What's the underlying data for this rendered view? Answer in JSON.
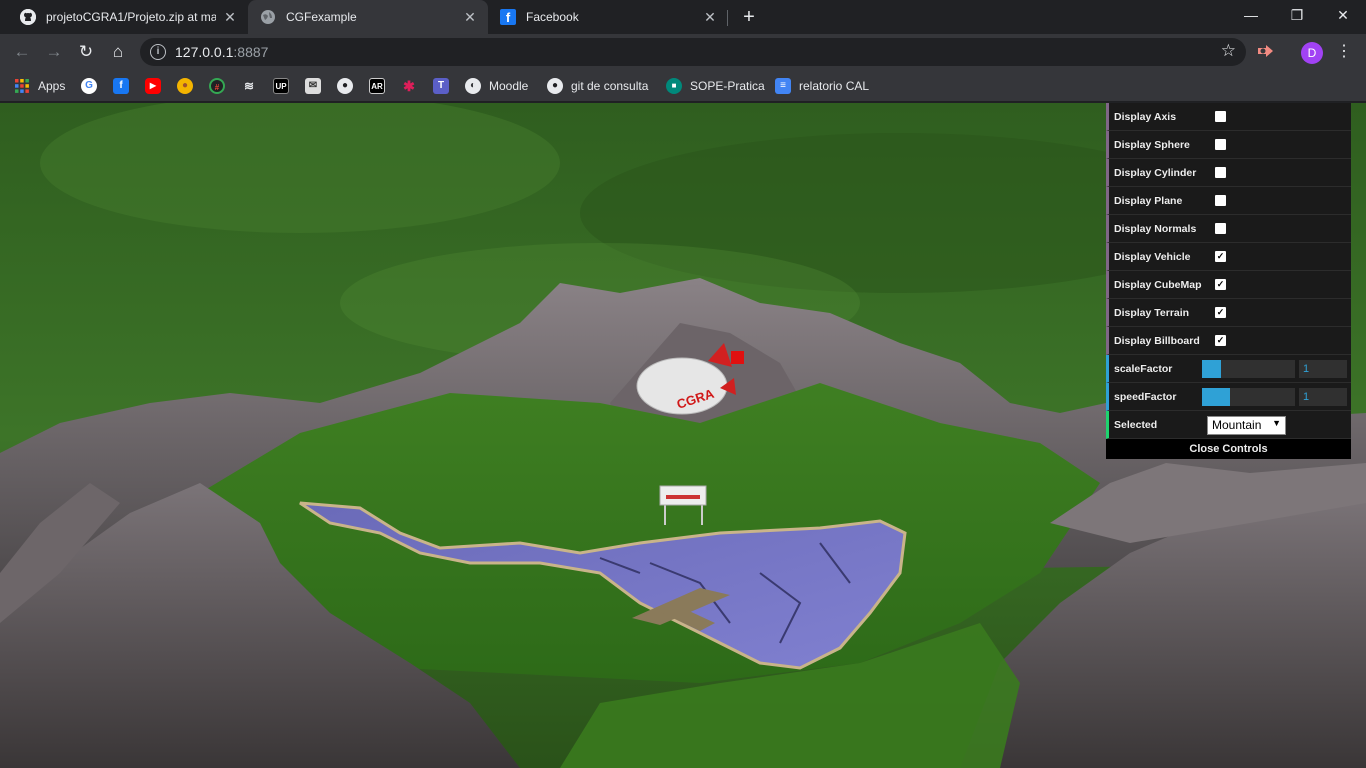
{
  "tabs": [
    {
      "title": "projetoCGRA1/Projeto.zip at mas",
      "favicon": "github-icon"
    },
    {
      "title": "CGFexample",
      "favicon": "globe-icon"
    },
    {
      "title": "Facebook",
      "favicon": "facebook-icon"
    }
  ],
  "window_controls": {
    "minimize": "—",
    "maximize": "❐",
    "close": "✕"
  },
  "address_bar": {
    "host": "127.0.0.1",
    "port": ":8887"
  },
  "profile": {
    "initial": "D"
  },
  "bookmarks": [
    {
      "label": "Apps",
      "icon": "apps-grid-icon"
    },
    {
      "label": "",
      "icon": "google-icon"
    },
    {
      "label": "",
      "icon": "facebook-icon"
    },
    {
      "label": "",
      "icon": "youtube-icon"
    },
    {
      "label": "",
      "icon": "chrome-extension-icon"
    },
    {
      "label": "",
      "icon": "bookmark-icon-5"
    },
    {
      "label": "",
      "icon": "bookmark-icon-6"
    },
    {
      "label": "",
      "icon": "bookmark-icon-7"
    },
    {
      "label": "",
      "icon": "mail-icon"
    },
    {
      "label": "",
      "icon": "github-icon"
    },
    {
      "label": "",
      "icon": "ar-icon"
    },
    {
      "label": "",
      "icon": "slack-icon"
    },
    {
      "label": "",
      "icon": "teams-icon"
    },
    {
      "label": "Moodle",
      "icon": "globe-icon"
    },
    {
      "label": "git de consulta",
      "icon": "github-icon"
    },
    {
      "label": "SOPE-Pratica",
      "icon": "meet-icon"
    },
    {
      "label": "relatorio CAL",
      "icon": "docs-icon"
    }
  ],
  "gui": {
    "booleans": [
      {
        "label": "Display Axis",
        "checked": false
      },
      {
        "label": "Display Sphere",
        "checked": false
      },
      {
        "label": "Display Cylinder",
        "checked": false
      },
      {
        "label": "Display Plane",
        "checked": false
      },
      {
        "label": "Display Normals",
        "checked": false
      },
      {
        "label": "Display Vehicle",
        "checked": true
      },
      {
        "label": "Display CubeMap",
        "checked": true
      },
      {
        "label": "Display Terrain",
        "checked": true
      },
      {
        "label": "Display Billboard",
        "checked": true
      }
    ],
    "scale_factor": {
      "label": "scaleFactor",
      "value": "1",
      "fraction": 0.2
    },
    "speed_factor": {
      "label": "speedFactor",
      "value": "1",
      "fraction": 0.3
    },
    "selected": {
      "label": "Selected",
      "value": "Mountain"
    },
    "close_label": "Close Controls"
  },
  "scene": {
    "vehicle_text": "CGRA"
  }
}
